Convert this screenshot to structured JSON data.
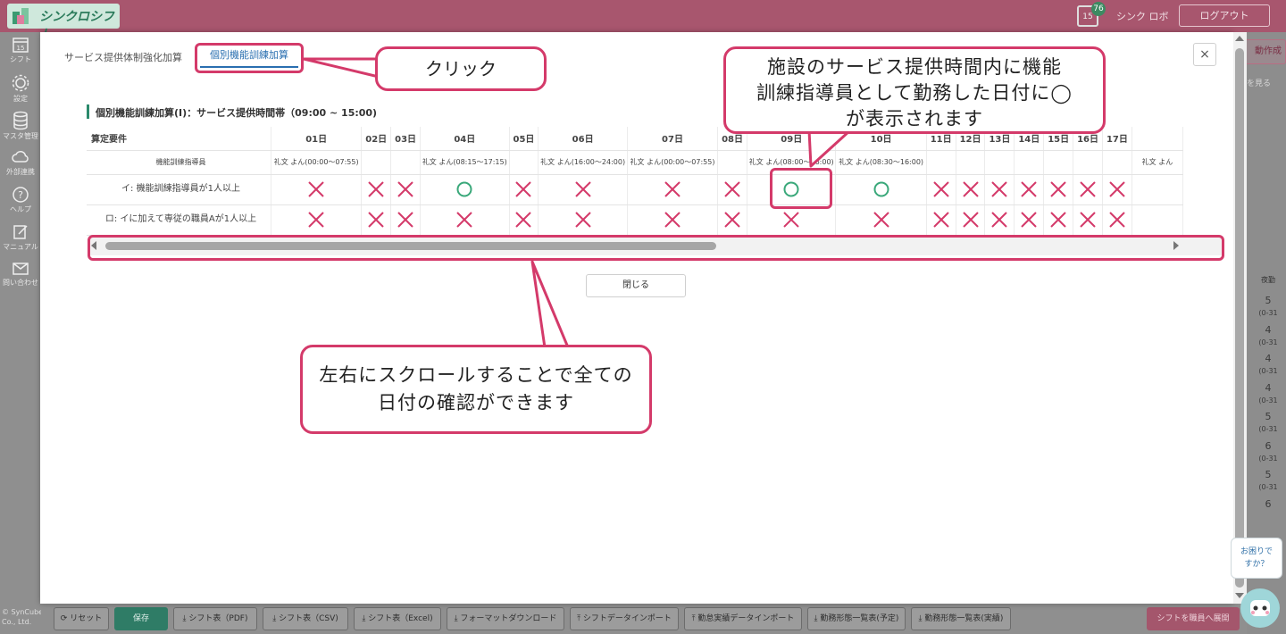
{
  "app": {
    "logo_text": "シンクロシフト",
    "notification_count": "76",
    "calendar_day": "15",
    "user_name": "シンク ロボ",
    "logout_label": "ログアウト"
  },
  "sidebar": {
    "items": [
      {
        "label": "シフト",
        "icon": "calendar-icon"
      },
      {
        "label": "設定",
        "icon": "gear-icon"
      },
      {
        "label": "マスタ管理",
        "icon": "database-icon"
      },
      {
        "label": "外部連携",
        "icon": "cloud-sync-icon"
      },
      {
        "label": "ヘルプ",
        "icon": "help-icon"
      },
      {
        "label": "マニュアル",
        "icon": "manual-icon"
      },
      {
        "label": "問い合わせ",
        "icon": "mail-icon"
      }
    ],
    "copyright": [
      "© SynCube",
      "Co., Ltd."
    ]
  },
  "right_panel": {
    "auto_button": "動作成",
    "see_link": "を見る",
    "column_head": "夜勤",
    "values": [
      {
        "num": "5",
        "sub": "(0-31"
      },
      {
        "num": "4",
        "sub": "(0-31"
      },
      {
        "num": "4",
        "sub": "(0-31"
      },
      {
        "num": "4",
        "sub": "(0-31"
      },
      {
        "num": "5",
        "sub": "(0-31"
      },
      {
        "num": "6",
        "sub": "(0-31"
      },
      {
        "num": "5",
        "sub": "(0-31"
      },
      {
        "num": "6",
        "sub": ""
      }
    ]
  },
  "modal": {
    "tabs": [
      {
        "label": "サービス提供体制強化加算",
        "active": false
      },
      {
        "label": "個別機能訓練加算",
        "active": true
      }
    ],
    "close_icon": "×",
    "section_title": "個別機能訓練加算(Ⅰ)：サービス提供時間帯（09:00 ~ 15:00)",
    "table": {
      "header_label": "算定要件",
      "days": [
        "01日",
        "02日",
        "03日",
        "04日",
        "05日",
        "06日",
        "07日",
        "08日",
        "09日",
        "10日",
        "11日",
        "12日",
        "13日",
        "14日",
        "15日",
        "16日",
        "17日",
        ""
      ],
      "rows": [
        {
          "label": "機能訓練指導員",
          "type": "staff",
          "cells": [
            "礼文 よん(00:00〜07:55)",
            "",
            "",
            "礼文 よん(08:15〜17:15)",
            "",
            "礼文 よん(16:00〜24:00)",
            "礼文 よん(00:00〜07:55)",
            "",
            "礼文 よん(08:00〜16:00)",
            "礼文 よん(08:30〜16:00)",
            "",
            "",
            "",
            "",
            "",
            "",
            "",
            "礼文 よん"
          ]
        },
        {
          "label": "イ: 機能訓練指導員が1人以上",
          "type": "mark",
          "cells": [
            "x",
            "x",
            "x",
            "o",
            "x",
            "x",
            "x",
            "x",
            "o",
            "o",
            "x",
            "x",
            "x",
            "x",
            "x",
            "x",
            "x",
            ""
          ]
        },
        {
          "label": "ロ: イに加えて専従の職員Aが1人以上",
          "type": "mark",
          "cells": [
            "x",
            "x",
            "x",
            "x",
            "x",
            "x",
            "x",
            "x",
            "x",
            "x",
            "x",
            "x",
            "x",
            "x",
            "x",
            "x",
            "x",
            ""
          ]
        }
      ]
    },
    "close_button": "閉じる"
  },
  "bottom_toolbar": {
    "buttons": [
      {
        "label": "リセット",
        "icon": "reset-icon"
      },
      {
        "label": "保存",
        "icon": ""
      },
      {
        "label": "シフト表（PDF)",
        "icon": "download-icon"
      },
      {
        "label": "シフト表（CSV)",
        "icon": "download-icon"
      },
      {
        "label": "シフト表（Excel)",
        "icon": "download-icon"
      },
      {
        "label": "フォーマットダウンロード",
        "icon": "download-icon"
      },
      {
        "label": "シフトデータインポート",
        "icon": "upload-icon"
      },
      {
        "label": "勤怠実績データインポート",
        "icon": "upload-icon"
      },
      {
        "label": "勤務形態一覧表(予定)",
        "icon": "download-icon"
      },
      {
        "label": "勤務形態一覧表(実績)",
        "icon": "download-icon"
      },
      {
        "label": "シフトを職員へ展開",
        "icon": ""
      }
    ]
  },
  "help_widget": {
    "lines": [
      "お困りで",
      "すか？"
    ]
  },
  "annotations": {
    "click_callout": "クリック",
    "shift_callout": [
      "施設のサービス提供時間内に機能",
      "訓練指導員として勤務した日付に◯",
      "が表示されます"
    ],
    "scroll_callout": [
      "左右にスクロールすることで全ての",
      "日付の確認ができます"
    ]
  },
  "colors": {
    "brand_pink": "#a8566e",
    "brand_green": "#2b8a6c",
    "mark_x": "#d43a6a",
    "mark_o": "#3aa87a",
    "annotation": "#d43a6a",
    "active_tab": "#2a6fb0"
  }
}
